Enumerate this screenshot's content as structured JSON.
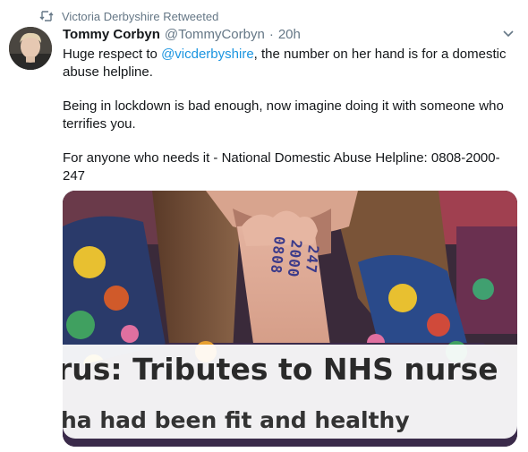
{
  "retweet": {
    "label": "Victoria Derbyshire Retweeted",
    "icon": "retweet-icon"
  },
  "tweet": {
    "display_name": "Tommy Corbyn",
    "handle": "@TommyCorbyn",
    "separator": "·",
    "time": "20h",
    "avatar_icon": "avatar",
    "more_icon": "chevron-down-icon",
    "text": {
      "p1_before": "Huge respect to ",
      "p1_mention": "@vicderbyshire",
      "p1_after": ", the number on her hand is for a domestic abuse helpline.",
      "p2": "Being in lockdown is bad enough, now imagine doing it with someone who terrifies you.",
      "p3": "For anyone who needs it - National Domestic Abuse Helpline: 0808-2000-247"
    }
  },
  "media": {
    "hand_line1": "0808",
    "hand_line2": "2000",
    "hand_line3": "247",
    "headline": "rus: Tributes to NHS nurse",
    "subline": "ha had been fit and healthy"
  },
  "colors": {
    "link": "#1b95e0",
    "muted": "#657786",
    "text": "#14171a"
  }
}
